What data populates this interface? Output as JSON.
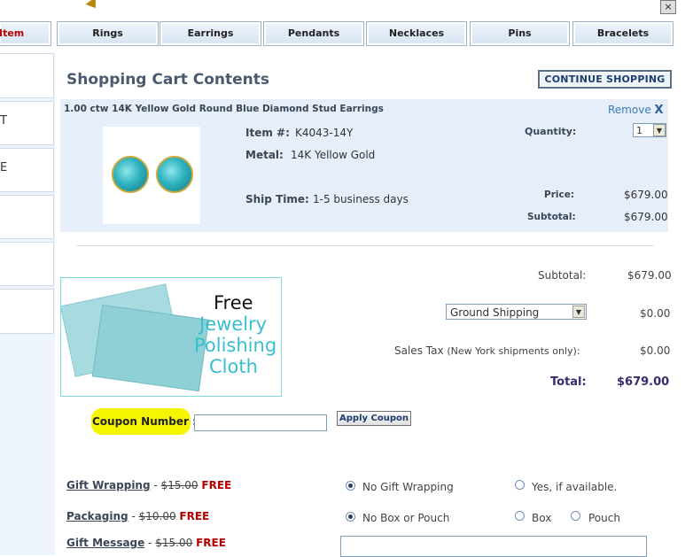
{
  "window": {
    "close_glyph": "×"
  },
  "nav": {
    "tabs": [
      {
        "label": "Item"
      },
      {
        "label": "Rings"
      },
      {
        "label": "Earrings"
      },
      {
        "label": "Pendants"
      },
      {
        "label": "Necklaces"
      },
      {
        "label": "Pins"
      },
      {
        "label": "Bracelets"
      }
    ]
  },
  "sidebar": {
    "items": [
      "",
      "T",
      "E",
      "",
      "",
      ""
    ]
  },
  "page": {
    "title": "Shopping Cart Contents",
    "continue_label": "CONTINUE SHOPPING"
  },
  "item": {
    "name": "1.00 ctw 14K Yellow Gold Round Blue Diamond Stud Earrings",
    "remove_label": "Remove",
    "remove_icon": "X",
    "item_no_label": "Item #:",
    "item_no": "K4043-14Y",
    "metal_label": "Metal:",
    "metal": "14K Yellow Gold",
    "ship_time_label": "Ship Time:",
    "ship_time": "1-5 business days",
    "quantity_label": "Quantity:",
    "quantity": "1",
    "price_label": "Price:",
    "price": "$679.00",
    "subtotal_label": "Subtotal:",
    "subtotal": "$679.00"
  },
  "promo": {
    "line1": "Free",
    "line2": "Jewelry",
    "line3": "Polishing",
    "line4": "Cloth"
  },
  "summary": {
    "subtotal_label": "Subtotal:",
    "subtotal": "$679.00",
    "shipping_option": "Ground Shipping",
    "shipping_cost": "$0.00",
    "tax_label": "Sales Tax",
    "tax_note": "(New York shipments only):",
    "tax": "$0.00",
    "total_label": "Total:",
    "total": "$679.00"
  },
  "coupon": {
    "label": "Coupon Number :",
    "value": "",
    "apply_label": "Apply Coupon"
  },
  "gift": {
    "wrapping": {
      "label": "Gift Wrapping",
      "old_price": "$15.00",
      "free": "FREE",
      "opt1": "No Gift Wrapping",
      "opt2": "Yes, if available."
    },
    "packaging": {
      "label": "Packaging",
      "old_price": "$10.00",
      "free": "FREE",
      "opt1": "No Box or Pouch",
      "opt2": "Box",
      "opt3": "Pouch"
    },
    "message": {
      "label": "Gift Message",
      "old_price": "$15.00",
      "free": "FREE"
    }
  },
  "colors": {
    "accent": "#4a5a6e",
    "free_red": "#b40000",
    "panel_blue": "#e6eff9",
    "highlight": "#f5f500"
  }
}
